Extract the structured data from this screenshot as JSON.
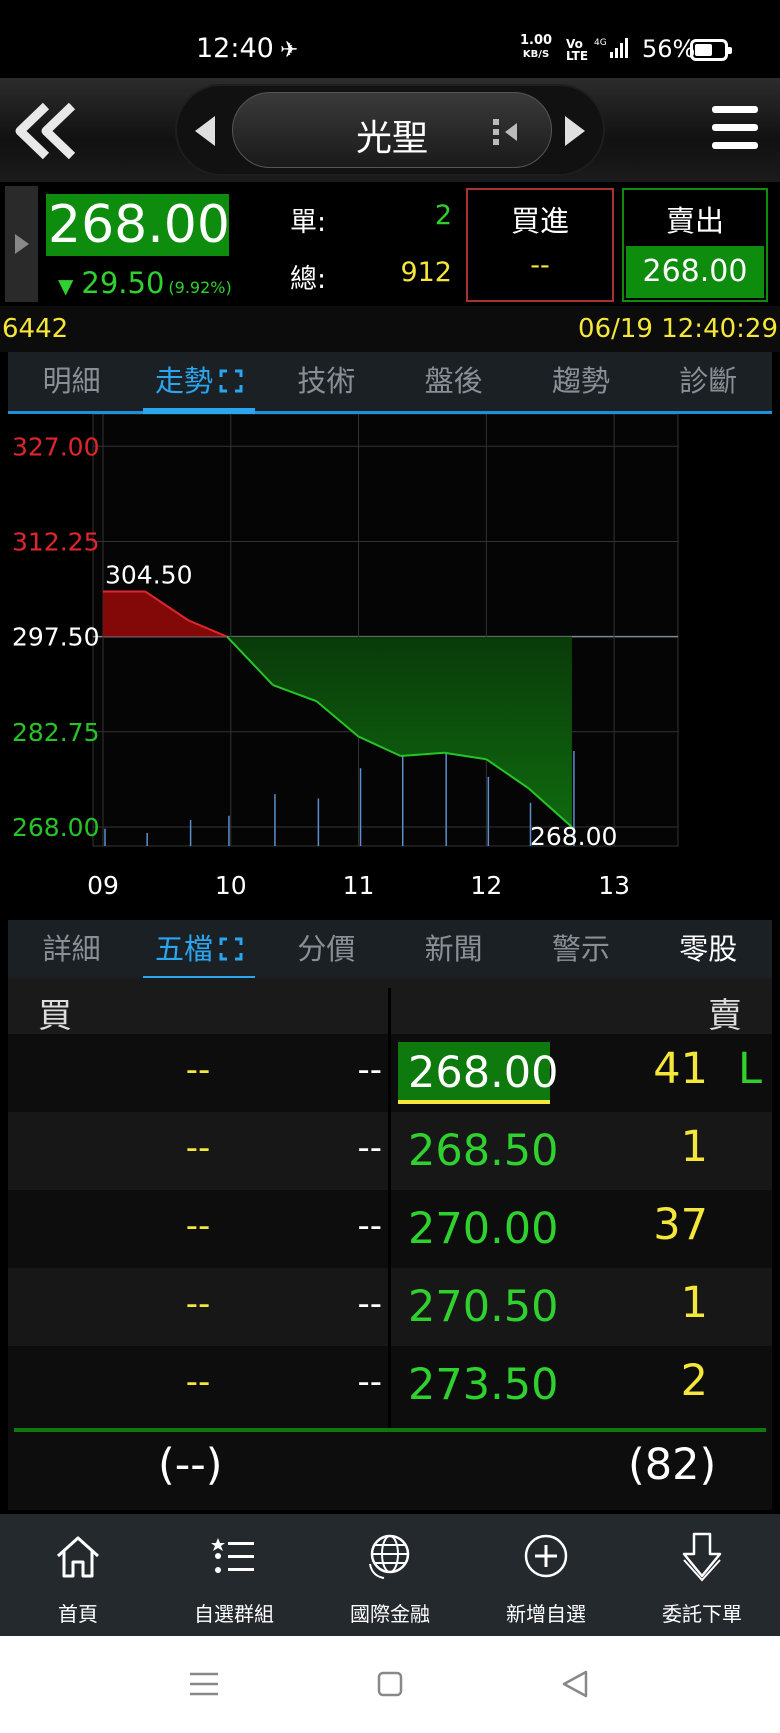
{
  "status": {
    "time": "12:40",
    "net_speed": "1.00",
    "net_unit": "KB/S",
    "volte": "Vo LTE",
    "network": "4G",
    "battery": "56%"
  },
  "header": {
    "title": "光聖",
    "back_icon": "double-chevron-left-icon",
    "menu_icon": "hamburger-menu-icon"
  },
  "quote": {
    "price": "268.00",
    "change": "29.50",
    "change_pct": "(9.92%)",
    "single_label": "單:",
    "single_value": "2",
    "total_label": "總:",
    "total_value": "912",
    "buy_label": "買進",
    "buy_value": "--",
    "sell_label": "賣出",
    "sell_value": "268.00"
  },
  "info": {
    "code": "6442",
    "datetime": "06/19 12:40:29"
  },
  "tabs_top": [
    "明細",
    "走勢",
    "技術",
    "盤後",
    "趨勢",
    "診斷"
  ],
  "tabs_bottom": [
    "詳細",
    "五檔",
    "分價",
    "新聞",
    "警示",
    "零股"
  ],
  "chart_data": {
    "type": "area",
    "reference": 297.5,
    "ylim": [
      265.05,
      332.0
    ],
    "yticks": [
      "327.00",
      "312.25",
      "297.50",
      "282.75",
      "268.00"
    ],
    "xticks": [
      "09",
      "10",
      "11",
      "12",
      "13"
    ],
    "x": [
      9.0,
      9.33,
      9.67,
      9.97,
      10.33,
      10.67,
      11.0,
      11.33,
      11.67,
      12.0,
      12.33,
      12.67
    ],
    "y": [
      304.5,
      304.5,
      300.0,
      297.5,
      290.0,
      287.5,
      282.0,
      279.0,
      279.5,
      278.5,
      274.0,
      268.0
    ],
    "volume": [
      0.04,
      0.03,
      0.06,
      0.07,
      0.12,
      0.11,
      0.18,
      0.37,
      0.4,
      0.16,
      0.1,
      0.22
    ],
    "high_label": "304.50",
    "low_label": "268.00",
    "colors": {
      "up": "#c0141c",
      "down": "#27c427",
      "ref": "#7f8a96",
      "grid": "#333333",
      "vol": "#5b8fd0"
    }
  },
  "orderbook": {
    "buy_header": "買",
    "sell_header": "賣",
    "rows": [
      {
        "buy_price": "--",
        "buy_vol": "--",
        "sell_price": "268.00",
        "sell_vol": "41",
        "flag": "L"
      },
      {
        "buy_price": "--",
        "buy_vol": "--",
        "sell_price": "268.50",
        "sell_vol": "1",
        "flag": ""
      },
      {
        "buy_price": "--",
        "buy_vol": "--",
        "sell_price": "270.00",
        "sell_vol": "37",
        "flag": ""
      },
      {
        "buy_price": "--",
        "buy_vol": "--",
        "sell_price": "270.50",
        "sell_vol": "1",
        "flag": ""
      },
      {
        "buy_price": "--",
        "buy_vol": "--",
        "sell_price": "273.50",
        "sell_vol": "2",
        "flag": ""
      }
    ],
    "buy_total": "(--)",
    "sell_total": "(82)"
  },
  "nav": [
    {
      "label": "首頁",
      "icon": "home-icon"
    },
    {
      "label": "自選群組",
      "icon": "list-star-icon"
    },
    {
      "label": "國際金融",
      "icon": "globe-icon"
    },
    {
      "label": "新增自選",
      "icon": "plus-circle-icon"
    },
    {
      "label": "委託下單",
      "icon": "download-arrow-icon"
    }
  ]
}
